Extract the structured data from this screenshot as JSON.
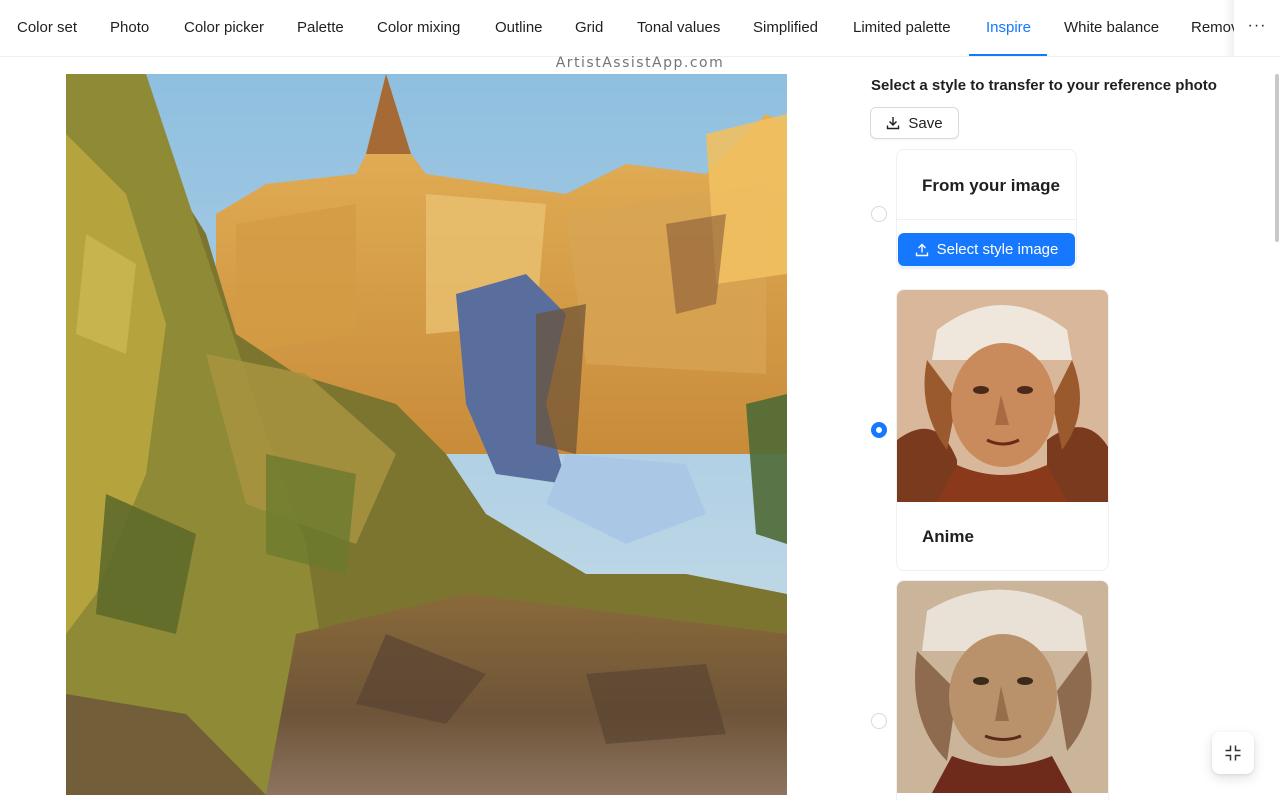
{
  "tabs": [
    {
      "label": "Color set",
      "active": false
    },
    {
      "label": "Photo",
      "active": false
    },
    {
      "label": "Color picker",
      "active": false
    },
    {
      "label": "Palette",
      "active": false
    },
    {
      "label": "Color mixing",
      "active": false
    },
    {
      "label": "Outline",
      "active": false
    },
    {
      "label": "Grid",
      "active": false
    },
    {
      "label": "Tonal values",
      "active": false
    },
    {
      "label": "Simplified",
      "active": false
    },
    {
      "label": "Limited palette",
      "active": false
    },
    {
      "label": "Inspire",
      "active": true
    },
    {
      "label": "White balance",
      "active": false
    },
    {
      "label": "Remov",
      "active": false
    }
  ],
  "more_icon": "ellipsis-icon",
  "watermark": "ArtistAssistApp.com",
  "panel": {
    "title": "Select a style to transfer to your reference photo",
    "save_label": "Save",
    "save_icon": "download-icon",
    "styles": [
      {
        "title": "From your image",
        "selected": false,
        "button_label": "Select style image",
        "button_icon": "upload-icon"
      },
      {
        "title": "Anime",
        "selected": true
      },
      {
        "title": "",
        "selected": false
      }
    ]
  },
  "fab_icon": "collapse-fullscreen-icon",
  "colors": {
    "accent": "#1677ff",
    "border": "#d9d9d9",
    "text": "rgba(0,0,0,0.88)"
  }
}
